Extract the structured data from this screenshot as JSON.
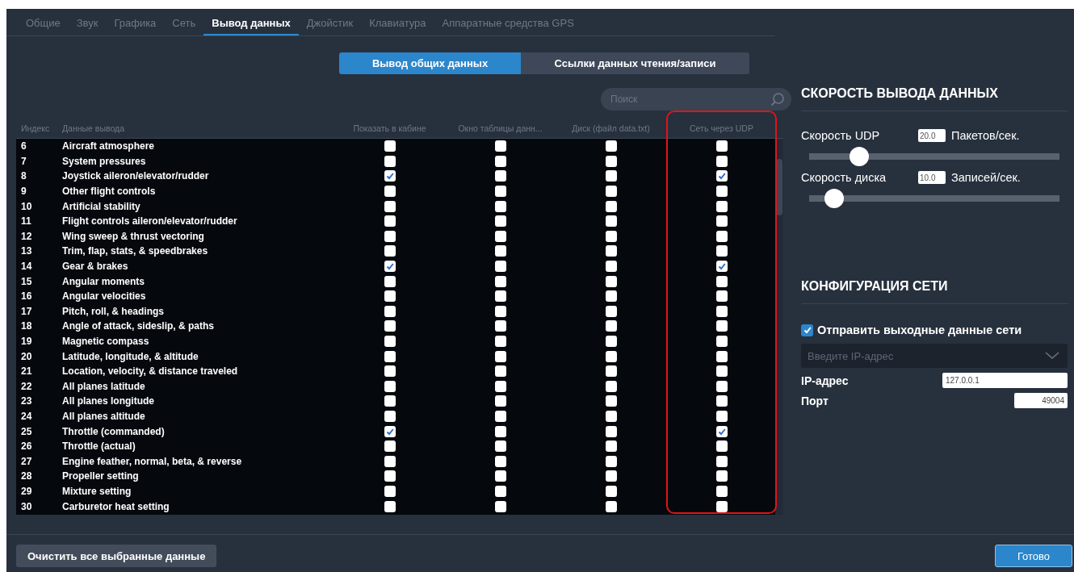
{
  "tabs": [
    {
      "label": "Общие",
      "selected": false
    },
    {
      "label": "Звук",
      "selected": false
    },
    {
      "label": "Графика",
      "selected": false
    },
    {
      "label": "Сеть",
      "selected": false
    },
    {
      "label": "Вывод данных",
      "selected": true
    },
    {
      "label": "Джойстик",
      "selected": false
    },
    {
      "label": "Клавиатура",
      "selected": false
    },
    {
      "label": "Аппаратные средства GPS",
      "selected": false
    }
  ],
  "segments": [
    {
      "label": "Вывод общих данных",
      "selected": true
    },
    {
      "label": "Ссылки данных чтения/записи",
      "selected": false
    }
  ],
  "search": {
    "placeholder": "Поиск"
  },
  "table": {
    "columns": [
      {
        "label": "Индекс",
        "kind": "index"
      },
      {
        "label": "Данные вывода",
        "kind": "name"
      },
      {
        "label": "Показать в кабине",
        "kind": "check"
      },
      {
        "label": "Окно таблицы данн...",
        "kind": "check"
      },
      {
        "label": "Диск (файл data.txt)",
        "kind": "check"
      },
      {
        "label": "Сеть через UDP",
        "kind": "check",
        "highlighted": true
      }
    ],
    "rows": [
      {
        "index": "6",
        "name": "Aircraft atmosphere",
        "checks": [
          false,
          false,
          false,
          false
        ]
      },
      {
        "index": "7",
        "name": "System pressures",
        "checks": [
          false,
          false,
          false,
          false
        ]
      },
      {
        "index": "8",
        "name": "Joystick aileron/elevator/rudder",
        "checks": [
          true,
          false,
          false,
          true
        ]
      },
      {
        "index": "9",
        "name": "Other flight controls",
        "checks": [
          false,
          false,
          false,
          false
        ]
      },
      {
        "index": "10",
        "name": "Artificial stability",
        "checks": [
          false,
          false,
          false,
          false
        ]
      },
      {
        "index": "11",
        "name": "Flight controls aileron/elevator/rudder",
        "checks": [
          false,
          false,
          false,
          false
        ]
      },
      {
        "index": "12",
        "name": "Wing sweep & thrust vectoring",
        "checks": [
          false,
          false,
          false,
          false
        ]
      },
      {
        "index": "13",
        "name": "Trim, flap, stats, & speedbrakes",
        "checks": [
          false,
          false,
          false,
          false
        ]
      },
      {
        "index": "14",
        "name": "Gear & brakes",
        "checks": [
          true,
          false,
          false,
          true
        ]
      },
      {
        "index": "15",
        "name": "Angular moments",
        "checks": [
          false,
          false,
          false,
          false
        ]
      },
      {
        "index": "16",
        "name": "Angular velocities",
        "checks": [
          false,
          false,
          false,
          false
        ]
      },
      {
        "index": "17",
        "name": "Pitch, roll, & headings",
        "checks": [
          false,
          false,
          false,
          false
        ]
      },
      {
        "index": "18",
        "name": "Angle of attack, sideslip, & paths",
        "checks": [
          false,
          false,
          false,
          false
        ]
      },
      {
        "index": "19",
        "name": "Magnetic compass",
        "checks": [
          false,
          false,
          false,
          false
        ]
      },
      {
        "index": "20",
        "name": "Latitude, longitude, & altitude",
        "checks": [
          false,
          false,
          false,
          false
        ]
      },
      {
        "index": "21",
        "name": "Location, velocity, & distance traveled",
        "checks": [
          false,
          false,
          false,
          false
        ]
      },
      {
        "index": "22",
        "name": "All planes latitude",
        "checks": [
          false,
          false,
          false,
          false
        ]
      },
      {
        "index": "23",
        "name": "All planes longitude",
        "checks": [
          false,
          false,
          false,
          false
        ]
      },
      {
        "index": "24",
        "name": "All planes altitude",
        "checks": [
          false,
          false,
          false,
          false
        ]
      },
      {
        "index": "25",
        "name": "Throttle (commanded)",
        "checks": [
          true,
          false,
          false,
          true
        ]
      },
      {
        "index": "26",
        "name": "Throttle (actual)",
        "checks": [
          false,
          false,
          false,
          false
        ]
      },
      {
        "index": "27",
        "name": "Engine feather, normal, beta, & reverse",
        "checks": [
          false,
          false,
          false,
          false
        ]
      },
      {
        "index": "28",
        "name": "Propeller setting",
        "checks": [
          false,
          false,
          false,
          false
        ]
      },
      {
        "index": "29",
        "name": "Mixture setting",
        "checks": [
          false,
          false,
          false,
          false
        ]
      },
      {
        "index": "30",
        "name": "Carburetor heat setting",
        "checks": [
          false,
          false,
          false,
          false
        ]
      }
    ]
  },
  "rate": {
    "title": "СКОРОСТЬ ВЫВОДА ДАННЫХ",
    "sliders": [
      {
        "label": "Скорость UDP",
        "value": "20.0",
        "unit": "Пакетов/сек.",
        "level": 0.2
      },
      {
        "label": "Скорость диска",
        "value": "10.0",
        "unit": "Записей/сек.",
        "level": 0.1
      }
    ]
  },
  "network": {
    "title": "КОНФИГУРАЦИЯ СЕТИ",
    "send": {
      "label": "Отправить выходные данные сети",
      "checked": true
    },
    "dropdown": {
      "placeholder": "Введите IP-адрес"
    },
    "fields": [
      {
        "label": "IP-адрес",
        "value": "127.0.0.1",
        "kind": "wide"
      },
      {
        "label": "Порт",
        "value": "49004",
        "kind": "short"
      }
    ]
  },
  "buttons": [
    {
      "label": "Очистить все выбранные данные",
      "kind": "secondary"
    },
    {
      "label": "Готово",
      "kind": "primary"
    }
  ]
}
